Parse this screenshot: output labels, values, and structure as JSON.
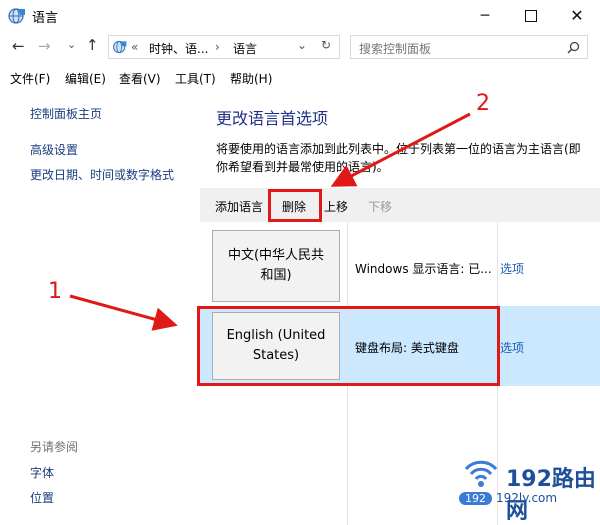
{
  "window": {
    "title": "语言"
  },
  "address": {
    "breadcrumb_sep": "«",
    "crumb1": "时钟、语...",
    "crumb_arrow": "›",
    "crumb2": "语言",
    "dropdown": "⌄",
    "refresh": "↻"
  },
  "search": {
    "placeholder": "搜索控制面板"
  },
  "menubar": [
    "文件(F)",
    "编辑(E)",
    "查看(V)",
    "工具(T)",
    "帮助(H)"
  ],
  "sidebar": {
    "home": "控制面板主页",
    "links": [
      "高级设置",
      "更改日期、时间或数字格式"
    ],
    "see_also_title": "另请参阅",
    "see_also": [
      "字体",
      "位置"
    ]
  },
  "main": {
    "heading": "更改语言首选项",
    "desc_line1": "将要使用的语言添加到此列表中。位于列表第一位的语言为主语言(即",
    "desc_line2": "你希望看到并最常使用的语言)。"
  },
  "toolbar": {
    "add": "添加语言",
    "remove": "删除",
    "move_up": "上移",
    "move_down": "下移"
  },
  "languages": [
    {
      "tile_line1": "中文(中华人民共",
      "tile_line2": "和国)",
      "info": "Windows 显示语言: 已...",
      "options": "选项"
    },
    {
      "tile_line1": "English (United",
      "tile_line2": "States)",
      "info": "键盘布局: 美式键盘",
      "options": "选项",
      "selected": true
    }
  ],
  "annotations": {
    "label1": "1",
    "label2": "2",
    "color": "#e01818"
  },
  "watermark": {
    "main": "192路由网",
    "sub": "192ly.com",
    "prefix": "192"
  }
}
